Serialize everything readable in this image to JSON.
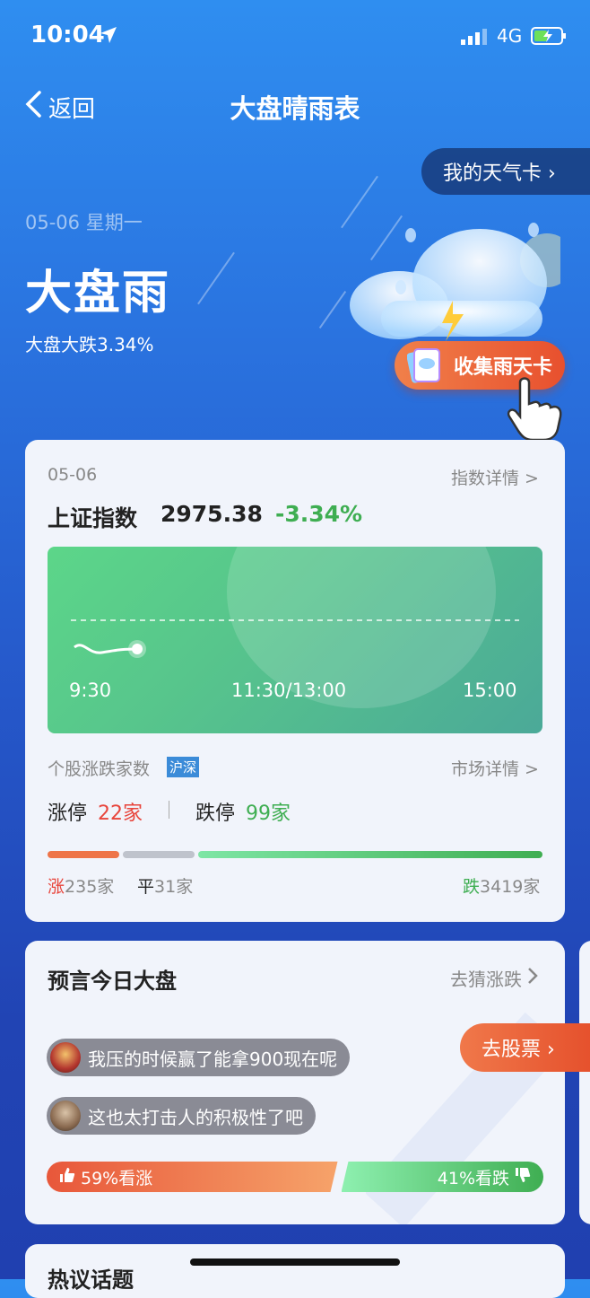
{
  "status_bar": {
    "time": "10:04",
    "network": "4G"
  },
  "nav": {
    "back_label": "返回",
    "title": "大盘晴雨表"
  },
  "weather_card_button": "我的天气卡 ›",
  "hero": {
    "date": "05-06 星期一",
    "headline": "大盘雨",
    "summary": "大盘大跌3.34%",
    "collect_label": "收集雨天卡"
  },
  "index_card": {
    "date": "05-06",
    "detail_link": "指数详情 >",
    "index_name": "上证指数",
    "index_value": "2975.38",
    "change": "-3.34%",
    "time_labels": [
      "9:30",
      "11:30/13:00",
      "15:00"
    ],
    "breadth_label": "个股涨跌家数",
    "breadth_tag": "沪深",
    "market_link": "市场详情 >",
    "limit_up_label": "涨停",
    "limit_up_value": "22家",
    "limit_down_label": "跌停",
    "limit_down_value": "99家",
    "up_label": "涨",
    "up_value": "235家",
    "flat_label": "平",
    "flat_value": "31家",
    "down_label": "跌",
    "down_value": "3419家",
    "up_count": 235,
    "flat_count": 31,
    "down_count": 3419
  },
  "predict_card": {
    "title": "预言今日大盘",
    "guess_link": "去猜涨跌",
    "comments": [
      "我压的时候赢了能拿900现在呢",
      "这也太打击人的积极性了吧"
    ],
    "bull_label": "59%看涨",
    "bear_label": "41%看跌",
    "bull_percent": 59,
    "bear_percent": 41
  },
  "stock_button": "去股票 ›",
  "hot_topics_title": "热议话题",
  "colors": {
    "up": "#e8453c",
    "down": "#3fae52",
    "accent": "#2a74e0"
  }
}
